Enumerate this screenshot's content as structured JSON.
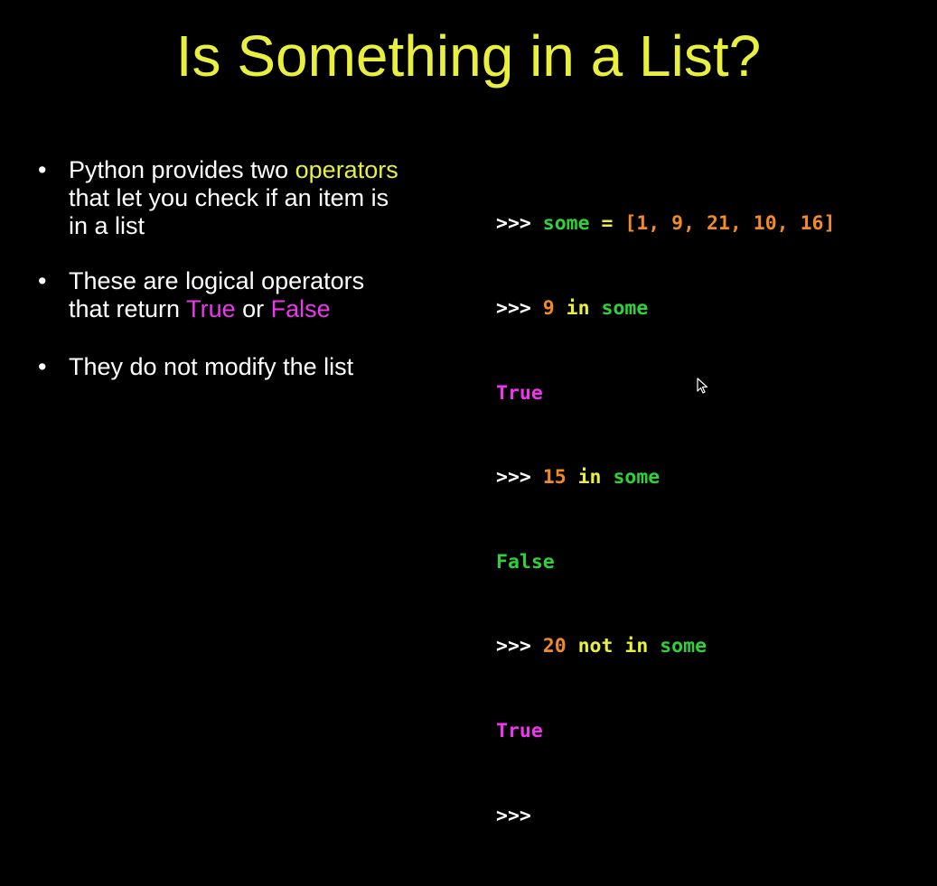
{
  "title": "Is Something in a List?",
  "bullets": [
    {
      "pre": "Python provides two ",
      "highlight": "operators",
      "post1": "that let you check if an item is",
      "post2": "in a list"
    },
    {
      "line1": "These are logical operators",
      "pre": "that return ",
      "true_word": "True",
      "mid": " or ",
      "false_word": "False"
    },
    {
      "text": "They do not modify the list"
    }
  ],
  "code": {
    "prompt": ">>> ",
    "line1": {
      "var": "some",
      "eq": " = ",
      "list": "[1, 9, 21, 10, 16]"
    },
    "line2": {
      "num": "9",
      "op": " in ",
      "var": "some"
    },
    "out1": "True",
    "line3": {
      "num": "15",
      "op": " in ",
      "var": "some"
    },
    "out2": "False",
    "line4": {
      "num": "20",
      "op": " not in ",
      "var": "some"
    },
    "out3": "True",
    "last_prompt": ">>>"
  },
  "colors": {
    "background": "#000000",
    "title": "#e8ef3e",
    "text": "#ffffff",
    "keyword_green": "#2fd13a",
    "number_orange": "#f08a2a",
    "operator_yellow": "#e8ef3e",
    "boolean_magenta": "#ee36ee"
  },
  "icons": {
    "cursor": "mouse-pointer-icon"
  }
}
